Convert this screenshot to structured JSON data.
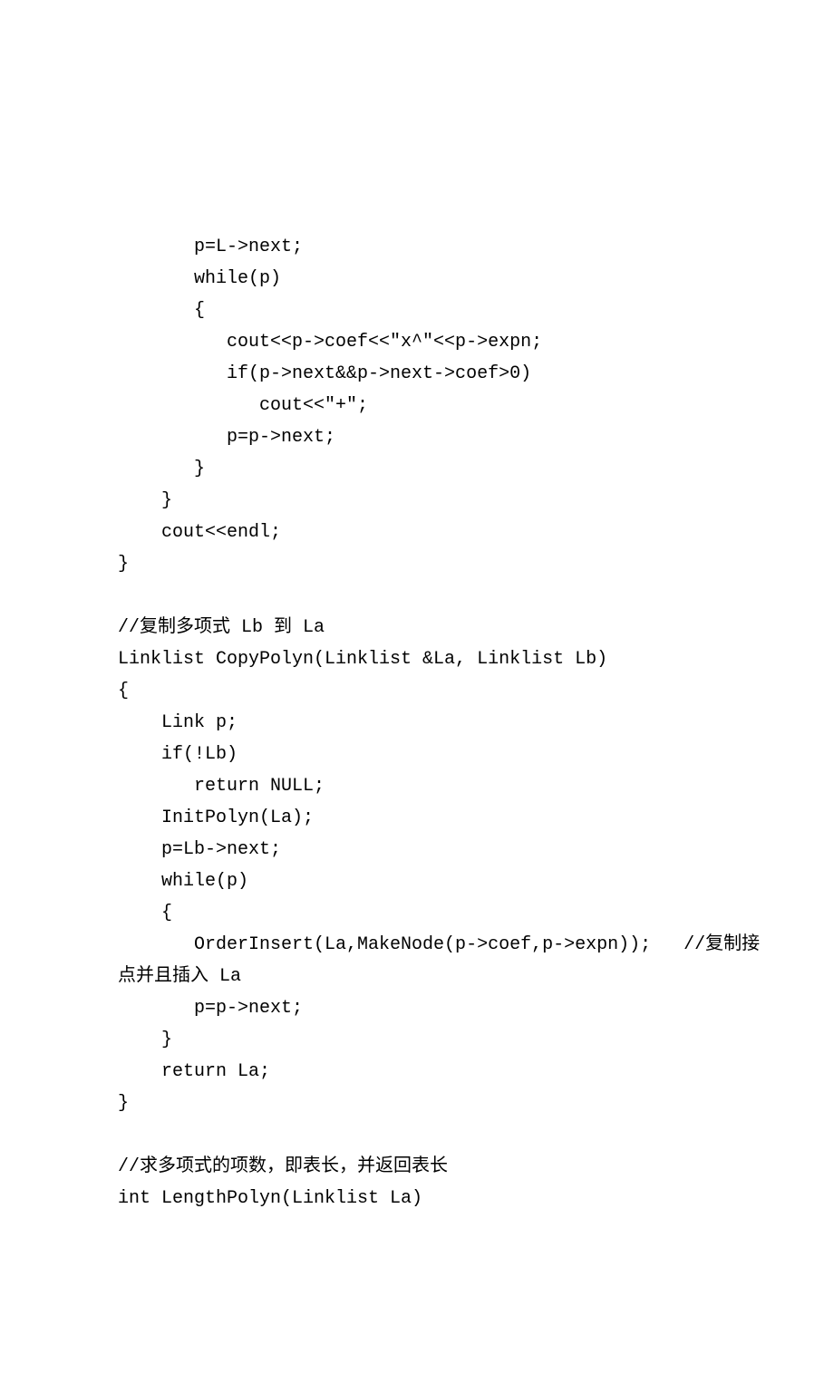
{
  "code_lines": [
    "       p=L->next;",
    "       while(p)",
    "       {",
    "          cout<<p->coef<<\"x^\"<<p->expn;",
    "          if(p->next&&p->next->coef>0)",
    "             cout<<\"+\";",
    "          p=p->next;",
    "       }",
    "    }",
    "    cout<<endl;",
    "}",
    "",
    "//复制多项式 Lb 到 La",
    "Linklist CopyPolyn(Linklist &La, Linklist Lb)",
    "{",
    "    Link p;",
    "    if(!Lb)",
    "       return NULL;",
    "    InitPolyn(La);",
    "    p=Lb->next;",
    "    while(p)",
    "    {",
    "       OrderInsert(La,MakeNode(p->coef,p->expn));   //复制接",
    "点并且插入 La",
    "       p=p->next;",
    "    }",
    "    return La;",
    "}",
    "",
    "//求多项式的项数，即表长，并返回表长",
    "int LengthPolyn(Linklist La)"
  ]
}
